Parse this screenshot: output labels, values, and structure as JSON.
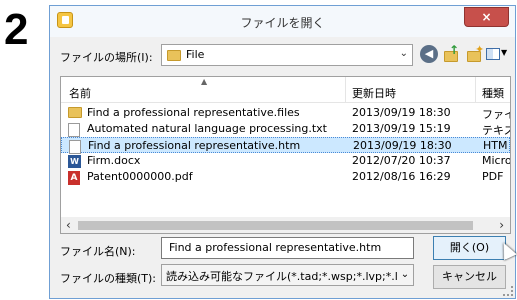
{
  "step_number": "2",
  "window": {
    "title": "ファイルを開く",
    "close_label": "×",
    "app_icon": "app-icon"
  },
  "location": {
    "label": "ファイルの場所(I):",
    "value": "File",
    "icon": "folder-icon"
  },
  "toolbar": {
    "back_label": "◀",
    "up_icon": "folder-up-icon",
    "new_folder_icon": "new-folder-icon",
    "view_icon": "view-menu-icon"
  },
  "columns": {
    "name": "名前",
    "date": "更新日時",
    "type": "種類"
  },
  "files": [
    {
      "name": "Find a professional representative.files",
      "date": "2013/09/19 18:30",
      "type": "ファイ.",
      "icon": "folder-icon",
      "selected": false
    },
    {
      "name": "Automated natural language processing.txt",
      "date": "2013/09/19 15:19",
      "type": "テキス",
      "icon": "text-file-icon",
      "selected": false
    },
    {
      "name": "Find a professional representative.htm",
      "date": "2013/09/19 18:30",
      "type": "HTM",
      "icon": "html-file-icon",
      "selected": true
    },
    {
      "name": "Firm.docx",
      "date": "2012/07/20 10:37",
      "type": "Micro",
      "icon": "word-file-icon",
      "selected": false
    },
    {
      "name": "Patent0000000.pdf",
      "date": "2012/08/16 16:29",
      "type": "PDF",
      "icon": "pdf-file-icon",
      "selected": false
    }
  ],
  "filename": {
    "label": "ファイル名(N):",
    "value": "Find a professional representative.htm"
  },
  "filetype": {
    "label": "ファイルの種類(T):",
    "value": "読み込み可能なファイル(*.tad;*.wsp;*.lvp;*.lvp)"
  },
  "buttons": {
    "open": "開く(O)",
    "cancel": "キャンセル"
  },
  "colors": {
    "selection": "#cce8ff",
    "close_button": "#c7504b",
    "folder": "#e9c25a"
  }
}
